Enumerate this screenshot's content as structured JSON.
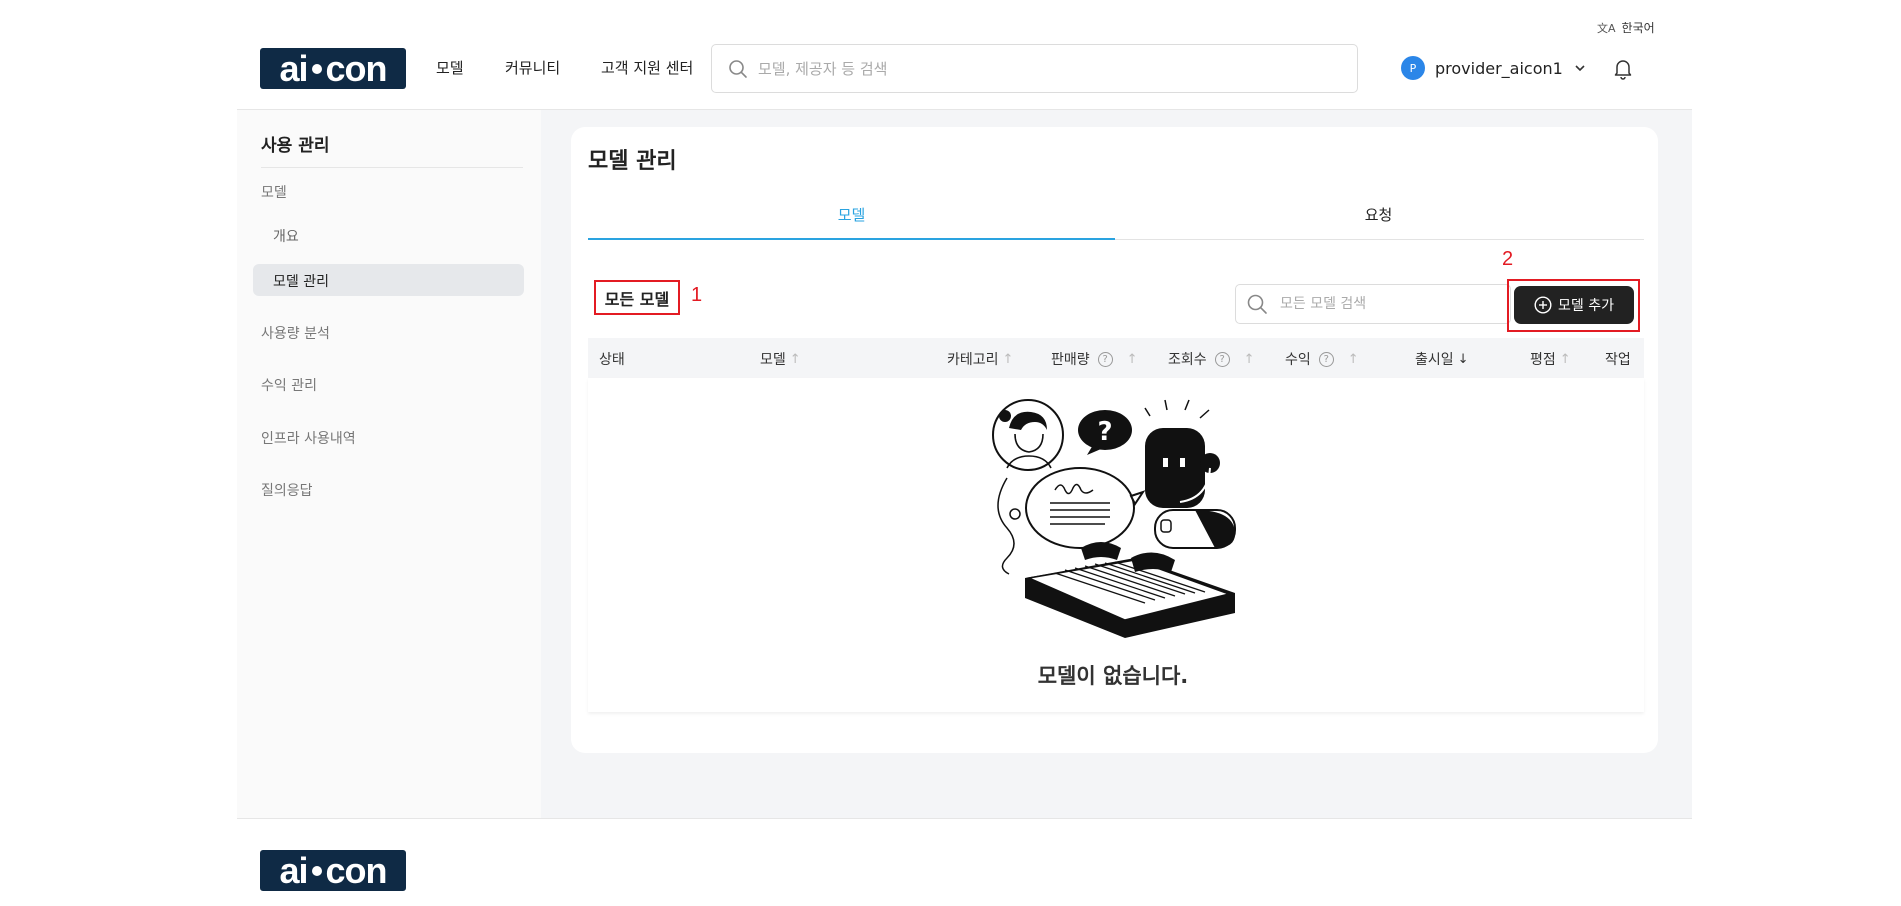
{
  "header": {
    "language": "한국어",
    "logo_text": "aicon",
    "nav": [
      "모델",
      "커뮤니티",
      "고객 지원 센터"
    ],
    "search_placeholder": "모델, 제공자 등 검색",
    "user": {
      "avatar_letter": "P",
      "name": "provider_aicon1"
    }
  },
  "sidebar": {
    "title": "사용 관리",
    "items": [
      {
        "label": "모델"
      },
      {
        "label": "개요"
      },
      {
        "label": "모델 관리"
      },
      {
        "label": "사용량 분석"
      },
      {
        "label": "수익 관리"
      },
      {
        "label": "인프라 사용내역"
      },
      {
        "label": "질의응답"
      }
    ]
  },
  "main": {
    "title": "모델 관리",
    "tabs": [
      {
        "label": "모델",
        "active": true
      },
      {
        "label": "요청",
        "active": false
      }
    ],
    "section_title": "모든 모델",
    "annotations": [
      "1",
      "2"
    ],
    "search_placeholder": "모든 모델 검색",
    "add_button": "모델 추가",
    "columns": [
      {
        "label": "상태"
      },
      {
        "label": "모델"
      },
      {
        "label": "카테고리"
      },
      {
        "label": "판매량"
      },
      {
        "label": "조회수"
      },
      {
        "label": "수익"
      },
      {
        "label": "출시일"
      },
      {
        "label": "평점"
      },
      {
        "label": "작업"
      }
    ],
    "empty_message": "모델이 없습니다."
  },
  "footer": {
    "logo_text": "aicon"
  },
  "colors": {
    "accent": "#2aa3e0",
    "brand": "#0f2a45",
    "button_dark": "#222222",
    "annotation_red": "#e31b23"
  }
}
